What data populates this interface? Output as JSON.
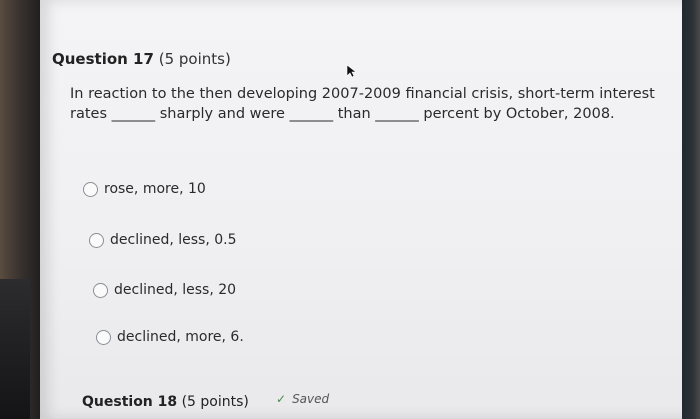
{
  "question": {
    "number": "Question 17",
    "points": "(5 points)",
    "text": "In reaction to the then developing 2007-2009 financial crisis, short-term interest rates ______ sharply and were ______ than ______ percent by October, 2008.",
    "options": [
      {
        "label": "rose, more, 10"
      },
      {
        "label": "declined, less, 0.5"
      },
      {
        "label": "declined, less, 20"
      },
      {
        "label": "declined, more, 6."
      }
    ]
  },
  "next_question": {
    "number": "Question 18",
    "points": "(5 points)",
    "status": "Saved",
    "status_icon": "check-icon"
  },
  "cursor_icon": "arrow-cursor-icon"
}
